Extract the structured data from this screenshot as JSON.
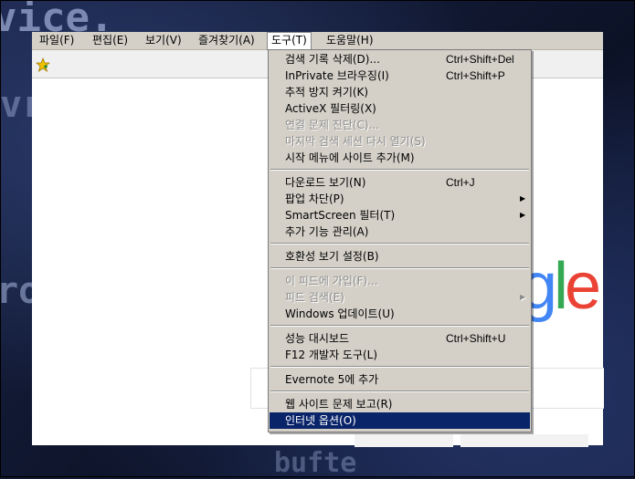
{
  "menubar": {
    "items": [
      {
        "label": "파일(F)"
      },
      {
        "label": "편집(E)"
      },
      {
        "label": "보기(V)"
      },
      {
        "label": "즐겨찾기(A)"
      },
      {
        "label": "도구(T)"
      },
      {
        "label": "도움말(H)"
      }
    ],
    "active_index": 4
  },
  "background_text": {
    "line1": "vice.",
    "line2": "vrit",
    "line3": "ror",
    "line4": "bufte"
  },
  "logo": {
    "g": "g",
    "l": "l",
    "e": "e",
    "colors": {
      "blue": "#4285f4",
      "green": "#34a853",
      "red": "#ea4335"
    }
  },
  "tools_menu": {
    "items": [
      {
        "label": "검색 기록 삭제(D)...",
        "shortcut": "Ctrl+Shift+Del",
        "disabled": false
      },
      {
        "label": "InPrivate 브라우징(I)",
        "shortcut": "Ctrl+Shift+P",
        "disabled": false
      },
      {
        "label": "추적 방지 켜기(K)",
        "shortcut": "",
        "disabled": false
      },
      {
        "label": "ActiveX 필터링(X)",
        "shortcut": "",
        "disabled": false
      },
      {
        "label": "연결 문제 진단(C)...",
        "shortcut": "",
        "disabled": true
      },
      {
        "label": "마지막 검색 세션 다시 열기(S)",
        "shortcut": "",
        "disabled": true
      },
      {
        "label": "시작 메뉴에 사이트 추가(M)",
        "shortcut": "",
        "disabled": false
      },
      {
        "label": "다운로드 보기(N)",
        "shortcut": "Ctrl+J",
        "disabled": false
      },
      {
        "label": "팝업 차단(P)",
        "shortcut": "",
        "disabled": false,
        "submenu": true
      },
      {
        "label": "SmartScreen 필터(T)",
        "shortcut": "",
        "disabled": false,
        "submenu": true
      },
      {
        "label": "추가 기능 관리(A)",
        "shortcut": "",
        "disabled": false
      },
      {
        "label": "호환성 보기 설정(B)",
        "shortcut": "",
        "disabled": false
      },
      {
        "label": "이 피드에 가입(F)...",
        "shortcut": "",
        "disabled": true
      },
      {
        "label": "피드 검색(E)",
        "shortcut": "",
        "disabled": true,
        "submenu": true
      },
      {
        "label": "Windows 업데이트(U)",
        "shortcut": "",
        "disabled": false
      },
      {
        "label": "성능 대시보드",
        "shortcut": "Ctrl+Shift+U",
        "disabled": false
      },
      {
        "label": "F12 개발자 도구(L)",
        "shortcut": "",
        "disabled": false
      },
      {
        "label": "Evernote 5에 추가",
        "shortcut": "",
        "disabled": false
      },
      {
        "label": "웹 사이트 문제 보고(R)",
        "shortcut": "",
        "disabled": false
      },
      {
        "label": "인터넷 옵션(O)",
        "shortcut": "",
        "disabled": false,
        "selected": true
      }
    ],
    "submenu_arrow": "▶"
  },
  "colors": {
    "menu_bg": "#d4d0c8",
    "selection": "#0a246a",
    "disabled_text": "#8c8c8c"
  }
}
